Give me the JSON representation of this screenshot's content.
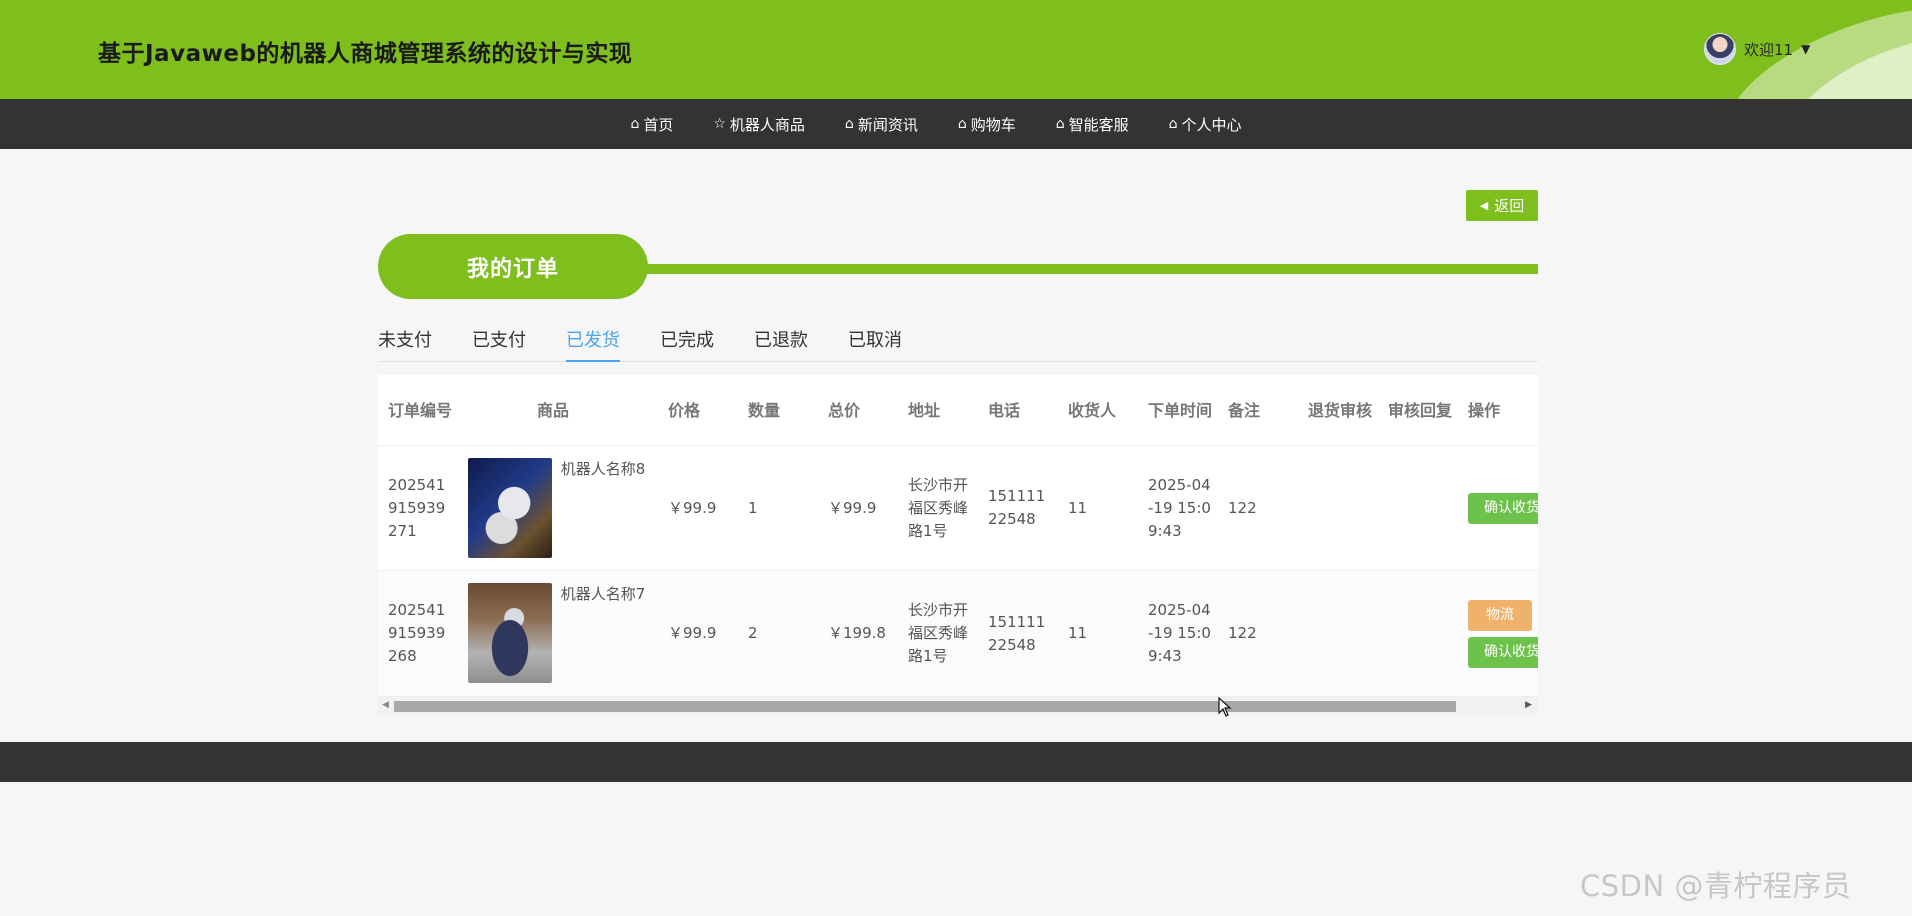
{
  "header": {
    "title": "基于Javaweb的机器人商城管理系统的设计与实现",
    "welcome": "欢迎11",
    "caret": "▼"
  },
  "nav": {
    "items": [
      {
        "label": "首页",
        "icon": "home-icon"
      },
      {
        "label": "机器人商品",
        "icon": "star-icon"
      },
      {
        "label": "新闻资讯",
        "icon": "bag-icon"
      },
      {
        "label": "购物车",
        "icon": "home-icon"
      },
      {
        "label": "智能客服",
        "icon": "home-icon"
      },
      {
        "label": "个人中心",
        "icon": "home-icon"
      }
    ],
    "icon_glyphs": [
      "⌂",
      "☆",
      "⌂",
      "⌂",
      "⌂",
      "⌂"
    ]
  },
  "back_button": {
    "label": "返回"
  },
  "section": {
    "title": "我的订单"
  },
  "tabs": [
    "未支付",
    "已支付",
    "已发货",
    "已完成",
    "已退款",
    "已取消"
  ],
  "active_tab": "已发货",
  "table": {
    "headers": {
      "order_no": "订单编号",
      "goods": "商品",
      "price": "价格",
      "qty": "数量",
      "total": "总价",
      "address": "地址",
      "phone": "电话",
      "receiver": "收货人",
      "order_time": "下单时间",
      "note": "备注",
      "refund_review": "退货审核",
      "review_reply": "审核回复",
      "ops": "操作"
    },
    "rows": [
      {
        "order_no": "202541915939271",
        "goods_name": "机器人名称8",
        "price": "￥99.9",
        "qty": "1",
        "total": "￥99.9",
        "address": "长沙市开福区秀峰路1号",
        "phone": "15111122548",
        "receiver": "11",
        "order_time": "2025-04-19 15:09:43",
        "note": "122",
        "refund_review": "",
        "review_reply": "",
        "confirm_label": "确认收货"
      },
      {
        "order_no": "202541915939268",
        "goods_name": "机器人名称7",
        "price": "￥99.9",
        "qty": "2",
        "total": "￥199.8",
        "address": "长沙市开福区秀峰路1号",
        "phone": "15111122548",
        "receiver": "11",
        "order_time": "2025-04-19 15:09:43",
        "note": "122",
        "refund_review": "",
        "review_reply": "",
        "logistics_label": "物流",
        "confirm_label": "确认收货"
      }
    ]
  },
  "watermark": "CSDN @青柠程序员",
  "colors": {
    "brand_green": "#7ebe1d",
    "nav_dark": "#333333",
    "tab_active": "#4aa3f0",
    "button_green": "#6cc24a",
    "button_orange": "#f0b26a"
  }
}
